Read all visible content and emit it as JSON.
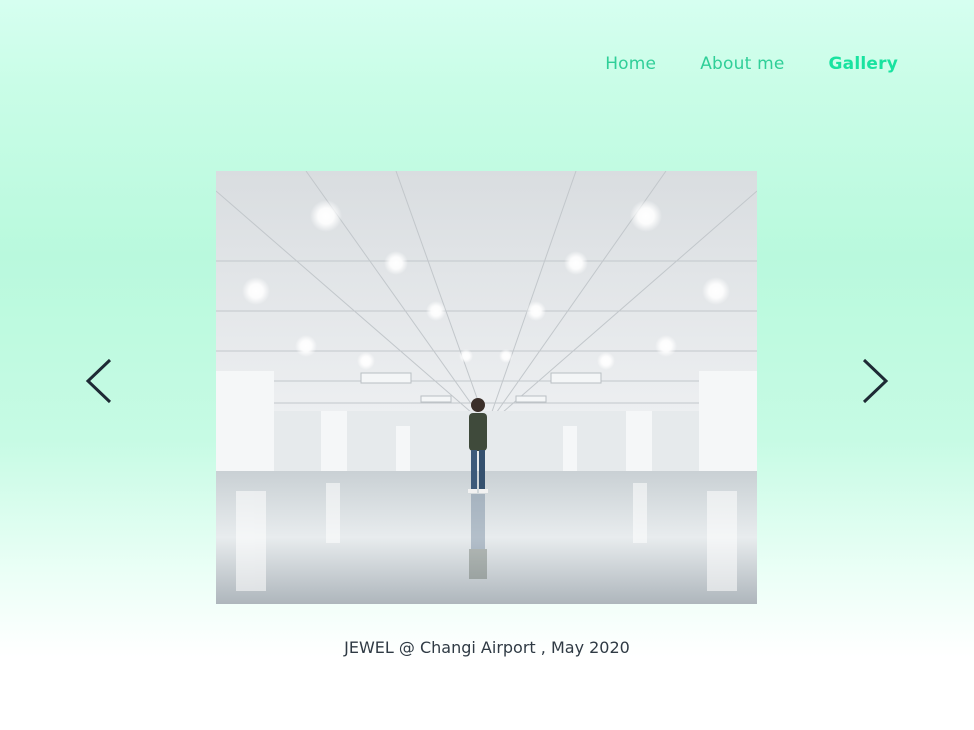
{
  "nav": {
    "items": [
      {
        "label": "Home",
        "active": false
      },
      {
        "label": "About me",
        "active": false
      },
      {
        "label": "Gallery",
        "active": true
      }
    ]
  },
  "gallery": {
    "caption": "JEWEL @ Changi Airport , May 2020",
    "prev_icon": "chevron-left-icon",
    "next_icon": "chevron-right-icon"
  },
  "colors": {
    "accent": "#19e3a0",
    "nav_text": "#2fcf98",
    "caption_text": "#2f3a44"
  }
}
